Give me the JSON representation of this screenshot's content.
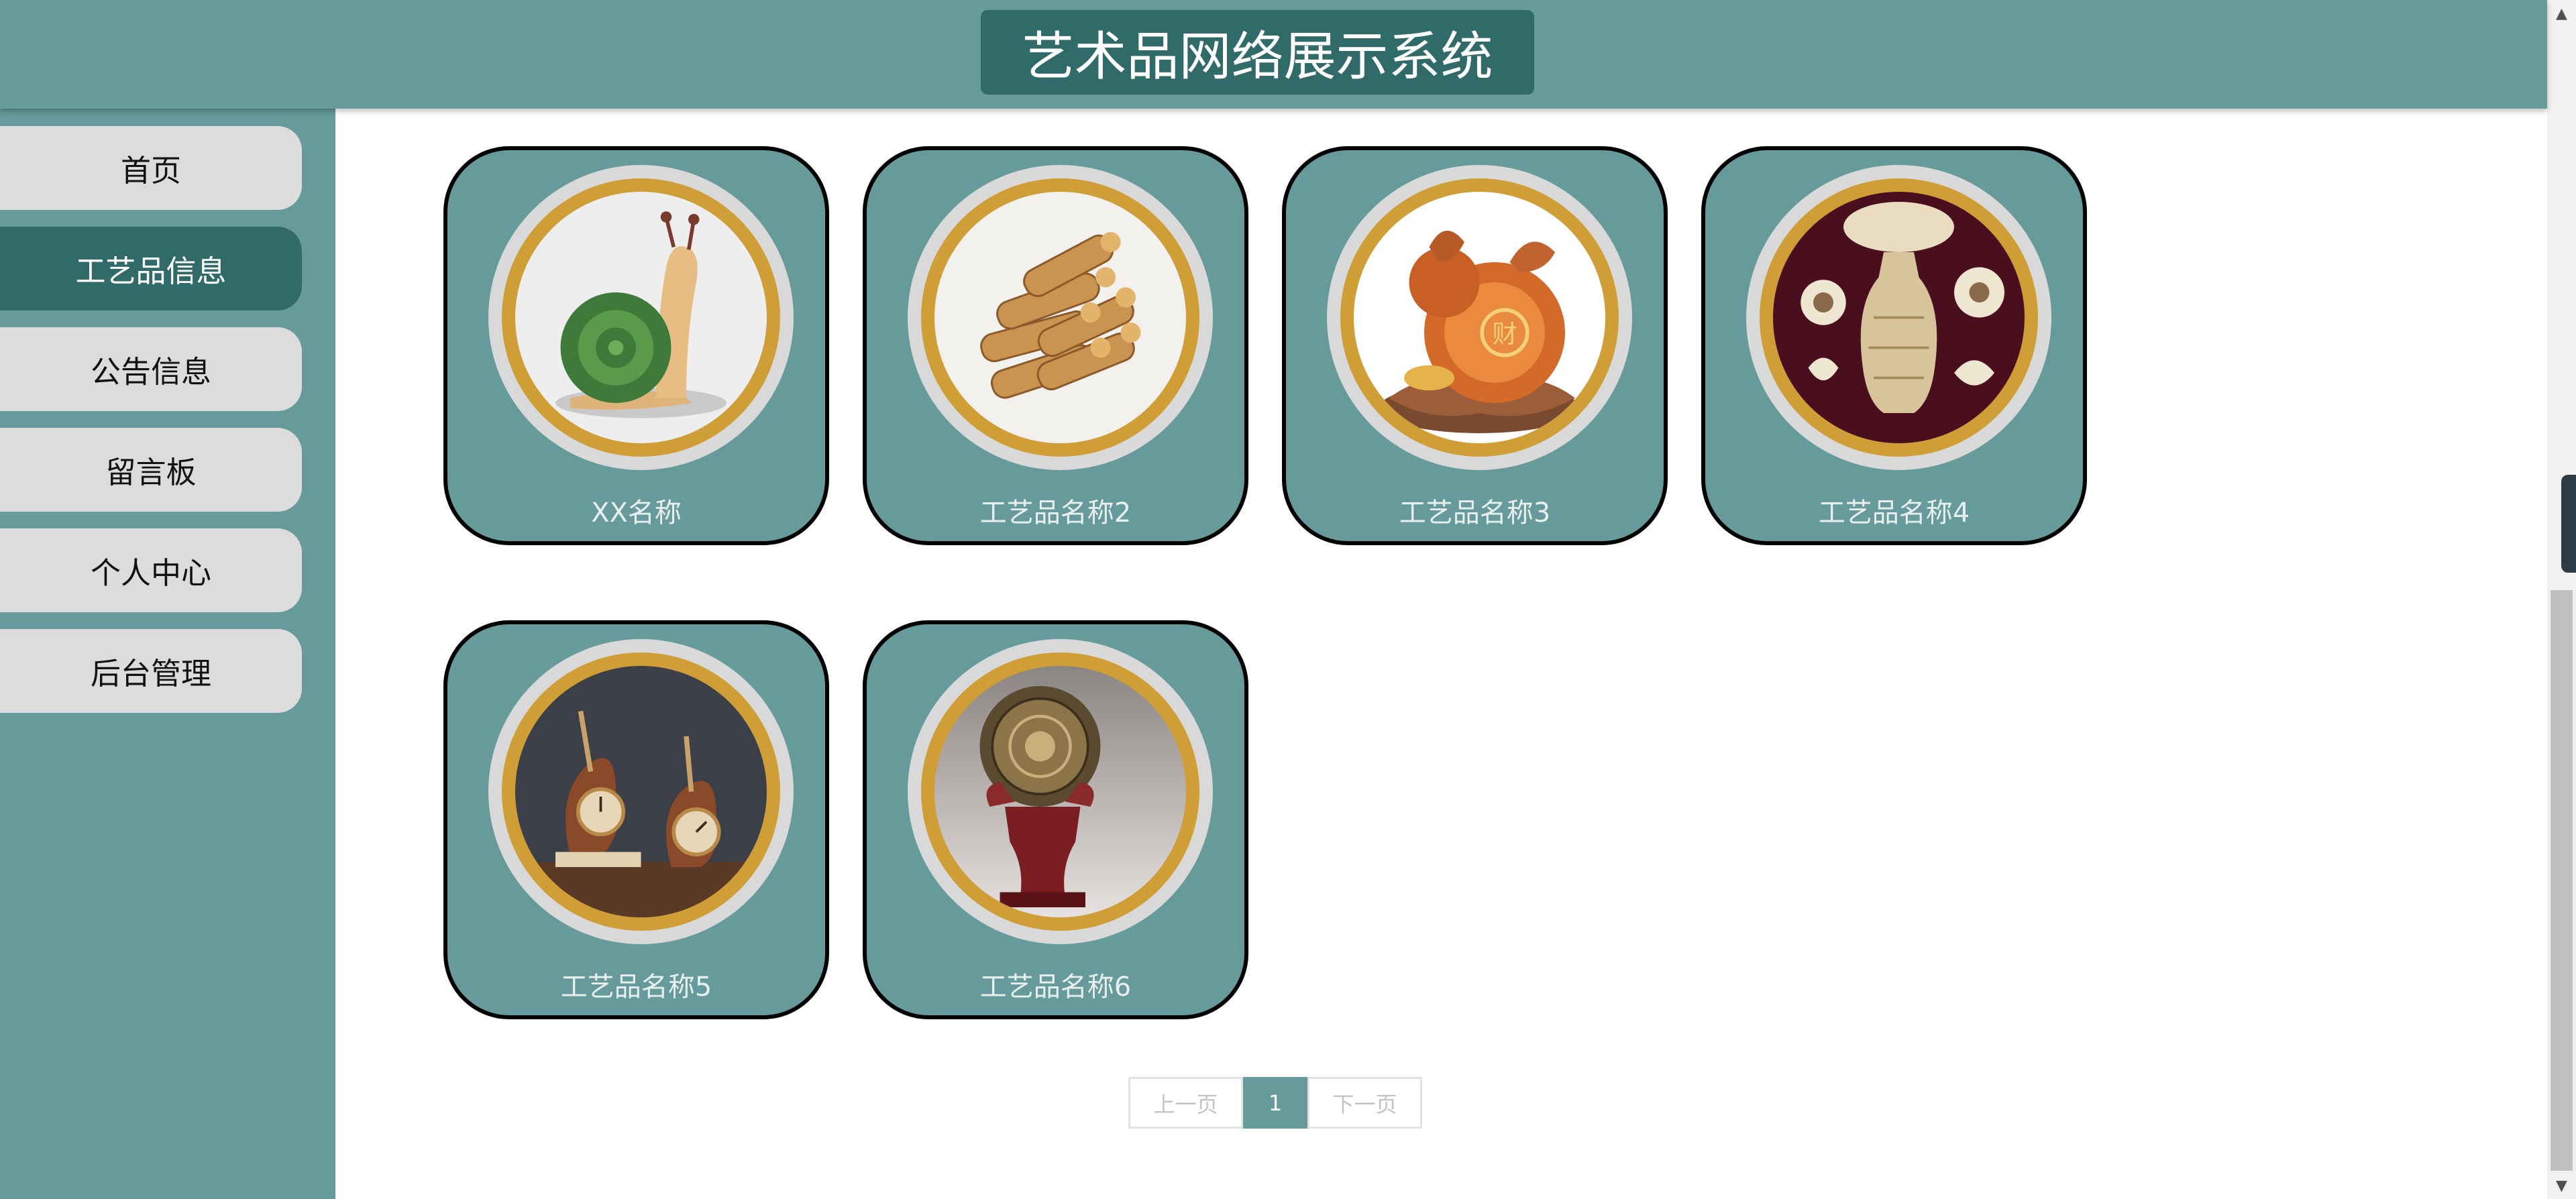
{
  "header": {
    "title": "艺术品网络展示系统"
  },
  "sidebar": {
    "items": [
      {
        "label": "首页"
      },
      {
        "label": "工艺品信息",
        "active": true
      },
      {
        "label": "公告信息"
      },
      {
        "label": "留言板"
      },
      {
        "label": "个人中心"
      },
      {
        "label": "后台管理"
      }
    ]
  },
  "products": [
    {
      "name": "XX名称",
      "image": "snail-figurine"
    },
    {
      "name": "工艺品名称2",
      "image": "bamboo-scrolls"
    },
    {
      "name": "工艺品名称3",
      "image": "copper-gourd"
    },
    {
      "name": "工艺品名称4",
      "image": "carved-vase"
    },
    {
      "name": "工艺品名称5",
      "image": "violin-clocks"
    },
    {
      "name": "工艺品名称6",
      "image": "bronze-drum"
    }
  ],
  "pagination": {
    "prev": "上一页",
    "current": "1",
    "next": "下一页"
  },
  "colors": {
    "primary": "#679a9a",
    "dark": "#306a69",
    "gold": "#cf9e36",
    "nav_bg": "#dcdcdc"
  }
}
